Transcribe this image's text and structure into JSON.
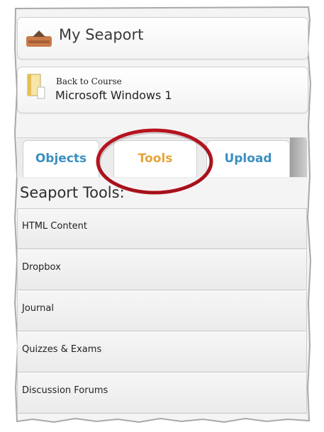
{
  "seaport": {
    "title": "My Seaport",
    "icon": "seaport-ship-icon"
  },
  "course": {
    "back_label": "Back to Course",
    "name": "Microsoft Windows 1",
    "icon": "course-book-icon"
  },
  "tabs": [
    {
      "label": "Objects",
      "active": false
    },
    {
      "label": "Tools",
      "active": true
    },
    {
      "label": "Upload",
      "active": false
    }
  ],
  "tools": {
    "heading": "Seaport Tools:",
    "items": [
      {
        "label": "HTML Content"
      },
      {
        "label": "Dropbox"
      },
      {
        "label": "Journal"
      },
      {
        "label": "Quizzes & Exams"
      },
      {
        "label": "Discussion Forums"
      }
    ]
  },
  "colors": {
    "tab_text": "#3a8fc0",
    "active_tab_text": "#e5a43a",
    "highlight_ring": "#b5141f"
  }
}
